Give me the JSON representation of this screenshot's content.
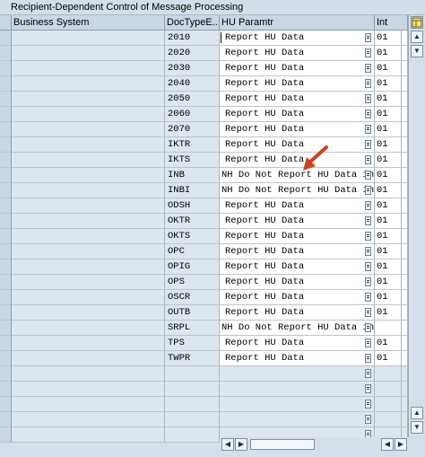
{
  "window": {
    "title": "Recipient-Dependent Control of Message Processing"
  },
  "columns": {
    "business_system": "Business System",
    "doc_type": "DocTypeE...",
    "hu_param": "HU Paramtr",
    "int": "Int"
  },
  "rows": [
    {
      "doc": "2010",
      "hu": "Report HU Data",
      "int": "01"
    },
    {
      "doc": "2020",
      "hu": "Report HU Data",
      "int": "01"
    },
    {
      "doc": "2030",
      "hu": "Report HU Data",
      "int": "01"
    },
    {
      "doc": "2040",
      "hu": "Report HU Data",
      "int": "01"
    },
    {
      "doc": "2050",
      "hu": "Report HU Data",
      "int": "01"
    },
    {
      "doc": "2060",
      "hu": "Report HU Data",
      "int": "01"
    },
    {
      "doc": "2070",
      "hu": "Report HU Data",
      "int": "01"
    },
    {
      "doc": "IKTR",
      "hu": "Report HU Data",
      "int": "01"
    },
    {
      "doc": "IKTS",
      "hu": "Report HU Data",
      "int": "01"
    },
    {
      "doc": "INB",
      "hu": "NH Do Not Report HU Data in C",
      "int": "01"
    },
    {
      "doc": "INBI",
      "hu": "NH Do Not Report HU Data in C",
      "int": "01"
    },
    {
      "doc": "ODSH",
      "hu": "Report HU Data",
      "int": "01"
    },
    {
      "doc": "OKTR",
      "hu": "Report HU Data",
      "int": "01"
    },
    {
      "doc": "OKTS",
      "hu": "Report HU Data",
      "int": "01"
    },
    {
      "doc": "OPC",
      "hu": "Report HU Data",
      "int": "01"
    },
    {
      "doc": "OPIG",
      "hu": "Report HU Data",
      "int": "01"
    },
    {
      "doc": "OPS",
      "hu": "Report HU Data",
      "int": "01"
    },
    {
      "doc": "OSCR",
      "hu": "Report HU Data",
      "int": "01"
    },
    {
      "doc": "OUTB",
      "hu": "Report HU Data",
      "int": "01"
    },
    {
      "doc": "SRPL",
      "hu": "NH Do Not Report HU Data in C",
      "int": ""
    },
    {
      "doc": "TPS",
      "hu": "Report HU Data",
      "int": "01"
    },
    {
      "doc": "TWPR",
      "hu": "Report HU Data",
      "int": "01"
    }
  ],
  "empty_rows": 5,
  "icons": {
    "column_settings": "table-settings-icon",
    "scroll_up": "scroll-up-arrow-icon",
    "scroll_down": "scroll-down-arrow-icon",
    "scroll_left": "scroll-left-arrow-icon",
    "scroll_right": "scroll-right-arrow-icon",
    "value_help": "f4-value-help-icon",
    "annotation": "red-arrow-annotation-icon"
  },
  "colors": {
    "header_bg": "#c9d6e3",
    "readonly_bg": "#dde6ee",
    "editable_bg": "#ffffff",
    "annotation": "#d2401c"
  }
}
